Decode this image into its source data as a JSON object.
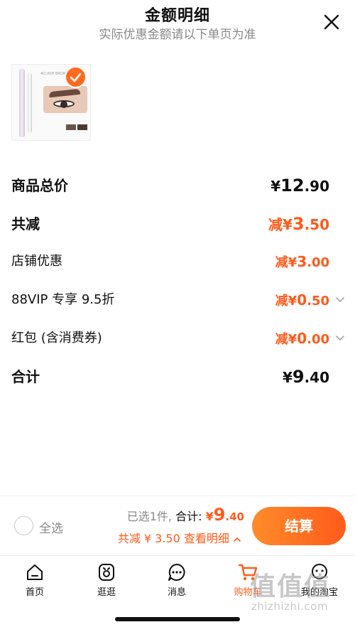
{
  "header": {
    "title": "金额明细",
    "subtitle": "实际优惠金额请以下单页为准"
  },
  "product": {
    "selected": true,
    "image_text": [
      "#2",
      "ASH BROWN"
    ]
  },
  "rows": [
    {
      "label": "商品总价",
      "value_sign": "",
      "value_yen": "¥",
      "value_int": "12",
      "value_dec": ".90"
    },
    {
      "label": "共减",
      "value_sign": "减",
      "value_yen": "¥",
      "value_int": "3",
      "value_dec": ".50"
    },
    {
      "label": "店铺优惠",
      "value_sign": "减",
      "value_yen": "¥",
      "value_int": "3",
      "value_dec": ".00"
    },
    {
      "label": "88VIP 专享 9.5折",
      "value_sign": "减",
      "value_yen": "¥",
      "value_int": "0",
      "value_dec": ".50"
    },
    {
      "label": "红包 (含消费券)",
      "value_sign": "减",
      "value_yen": "¥",
      "value_int": "0",
      "value_dec": ".00"
    },
    {
      "label": "合计",
      "value_sign": "",
      "value_yen": "¥",
      "value_int": "9",
      "value_dec": ".40"
    }
  ],
  "bottom_bar": {
    "select_all_label": "全选",
    "selected_count_text": "已选1件,",
    "total_label": "合计:",
    "total_yen": "¥",
    "total_int": "9",
    "total_dec": ".40",
    "discount_text": "共减 ¥ 3.50",
    "detail_link": "查看明细",
    "detail_icon": "chevron-up-icon",
    "checkout_label": "结算"
  },
  "tabs": [
    {
      "label": "首页",
      "icon": "home-icon",
      "active": false
    },
    {
      "label": "逛逛",
      "icon": "browse-icon",
      "active": false
    },
    {
      "label": "消息",
      "icon": "message-icon",
      "active": false
    },
    {
      "label": "购物车",
      "icon": "cart-icon",
      "active": true
    },
    {
      "label": "我的淘宝",
      "icon": "profile-icon",
      "active": false
    }
  ],
  "watermark": {
    "big": "值值值",
    "small": "zhizhizhi.com"
  },
  "colors": {
    "accent": "#ff5a1a",
    "accent_light": "#ff8c2a",
    "text": "#111111",
    "muted": "#888888"
  }
}
